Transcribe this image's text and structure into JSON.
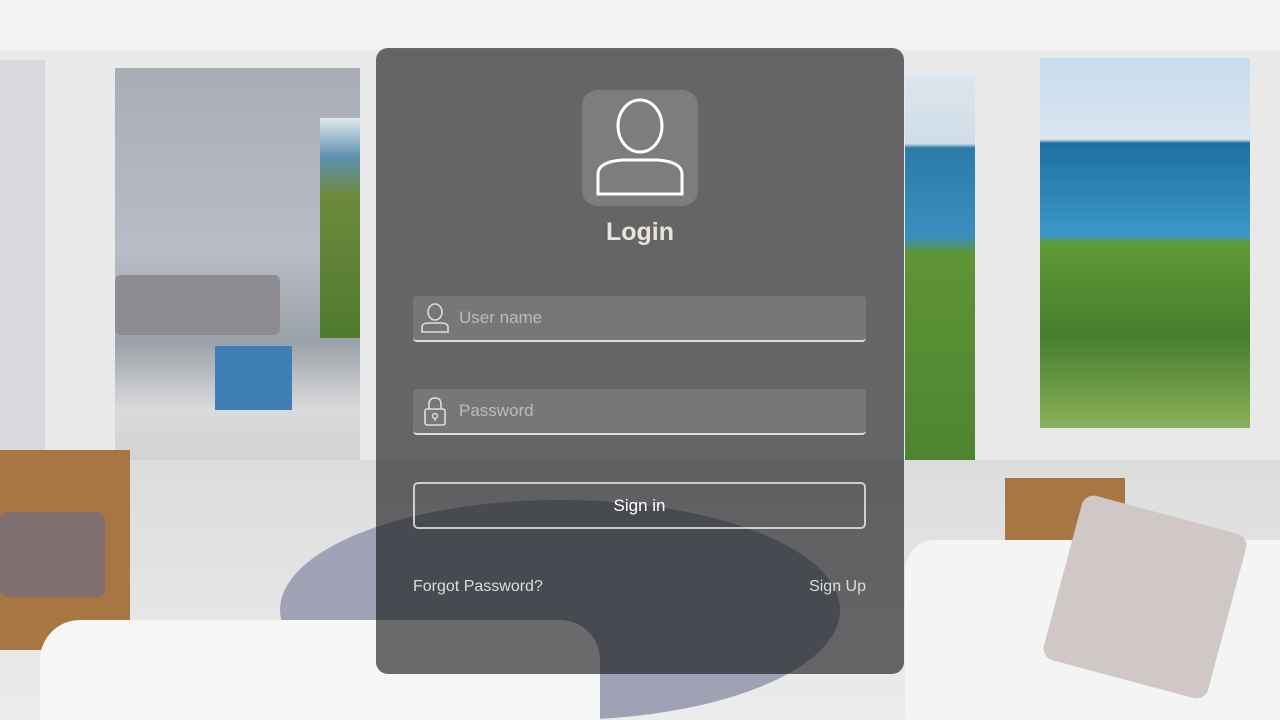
{
  "login": {
    "title": "Login",
    "username_placeholder": "User name",
    "password_placeholder": "Password",
    "signin_label": "Sign in",
    "forgot_label": "Forgot Password?",
    "signup_label": "Sign Up"
  },
  "icons": {
    "avatar": "user-icon",
    "username": "user-icon",
    "password": "lock-icon"
  }
}
